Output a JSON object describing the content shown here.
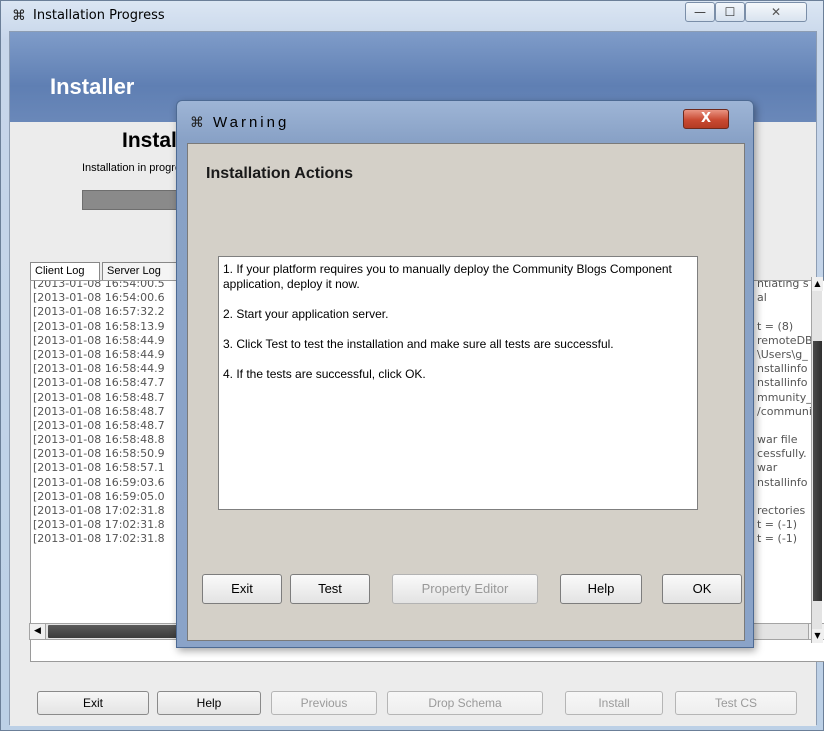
{
  "window": {
    "title": "Installation Progress",
    "icon": "installer-logo-icon",
    "minimize_glyph": "—",
    "maximize_glyph": "☐",
    "close_glyph": "✕"
  },
  "header": {
    "title": "Installer"
  },
  "main": {
    "heading": "Installation Progress",
    "subtitle": "Installation in progress",
    "progress_percent": 100
  },
  "tabs": [
    {
      "label": "Client Log"
    },
    {
      "label": "Server Log"
    }
  ],
  "log": {
    "timestamps": [
      "[2013-01-08 16:54:00.5",
      "[2013-01-08 16:54:00.6",
      "[2013-01-08 16:57:32.2",
      "[2013-01-08 16:58:13.9",
      "[2013-01-08 16:58:44.9",
      "[2013-01-08 16:58:44.9",
      "[2013-01-08 16:58:44.9",
      "[2013-01-08 16:58:47.7",
      "[2013-01-08 16:58:48.7",
      "[2013-01-08 16:58:48.7",
      "[2013-01-08 16:58:48.7",
      "[2013-01-08 16:58:48.8",
      "[2013-01-08 16:58:50.9",
      "[2013-01-08 16:58:57.1",
      "[2013-01-08 16:59:03.6",
      "[2013-01-08 16:59:05.0",
      "[2013-01-08 17:02:31.8",
      "[2013-01-08 17:02:31.8",
      "[2013-01-08 17:02:31.8"
    ],
    "tails": [
      "ntiating s",
      "al",
      "",
      "t = (8)",
      "remoteDB",
      "\\Users\\g_",
      "nstallinfo",
      "nstallinfo",
      "mmunity_",
      "/communi",
      "",
      "war file",
      "cessfully.",
      "war",
      "nstallinfo",
      "",
      "rectories",
      "t = (-1)",
      "t = (-1)"
    ]
  },
  "footer_buttons": {
    "exit": "Exit",
    "help": "Help",
    "previous": "Previous",
    "drop_schema": "Drop Schema",
    "install": "Install",
    "test_cs": "Test CS"
  },
  "dialog": {
    "title": "Warning",
    "close_glyph": "X",
    "heading": "Installation Actions",
    "steps": [
      "1. If your platform requires you to manually deploy the Community Blogs Component application, deploy it now.",
      "2. Start your application server.",
      "3. Click Test to test the installation and make sure all tests are successful.",
      "4. If the tests are successful, click OK."
    ],
    "buttons": {
      "exit": "Exit",
      "test": "Test",
      "property_editor": "Property Editor",
      "help": "Help",
      "ok": "OK"
    }
  },
  "colors": {
    "header_band": "#6f8ec1",
    "dialog_frame": "#8aa3c8",
    "close_button": "#c94a32",
    "disabled_text": "#9a9a9a"
  }
}
